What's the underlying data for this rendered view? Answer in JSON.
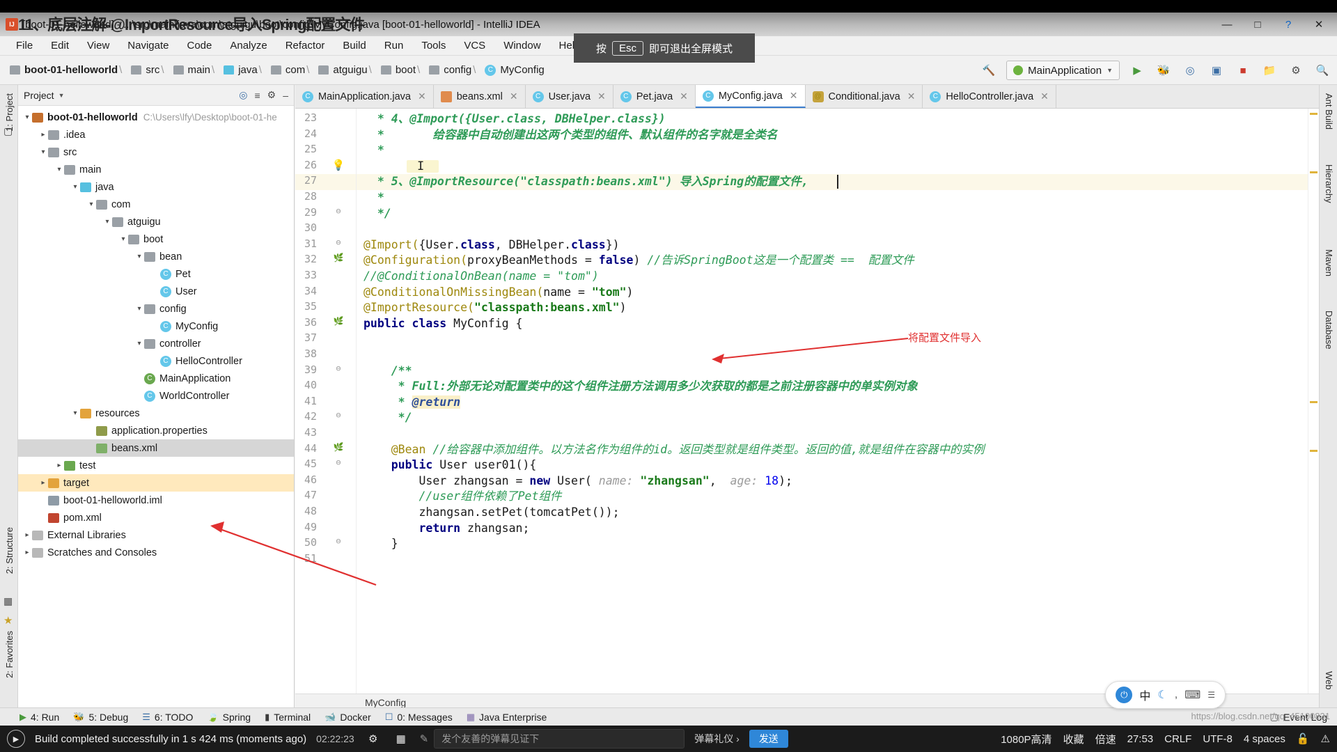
{
  "window": {
    "title": "[boot-01-helloworld] - ...\\src\\main\\java\\com\\atguigu\\boot\\config\\MyConfig.java [boot-01-helloworld] - IntelliJ IDEA",
    "overlay_title": "11、底层注解-@ImportResource导入Spring配置文件",
    "minimize": "—",
    "maximize": "□",
    "close": "✕",
    "help": "?"
  },
  "menubar": {
    "items": [
      "File",
      "Edit",
      "View",
      "Navigate",
      "Code",
      "Analyze",
      "Refactor",
      "Build",
      "Run",
      "Tools",
      "VCS",
      "Window",
      "Help"
    ]
  },
  "esc_hint": {
    "prefix": "按",
    "key": "Esc",
    "suffix": "即可退出全屏模式"
  },
  "navbar": {
    "crumbs": [
      {
        "label": "boot-01-helloworld",
        "icon": "module-icon",
        "bold": true
      },
      {
        "label": "src",
        "icon": "folder-icon"
      },
      {
        "label": "main",
        "icon": "folder-icon"
      },
      {
        "label": "java",
        "icon": "folder-source-icon"
      },
      {
        "label": "com",
        "icon": "folder-icon"
      },
      {
        "label": "atguigu",
        "icon": "folder-icon"
      },
      {
        "label": "boot",
        "icon": "folder-icon"
      },
      {
        "label": "config",
        "icon": "folder-icon"
      },
      {
        "label": "MyConfig",
        "icon": "class-icon"
      }
    ],
    "run_config": "MainApplication",
    "toolbar_icons": [
      "build-hammer-icon",
      "run-icon",
      "debug-icon",
      "coverage-icon",
      "profiler-icon",
      "stop-icon",
      "project-structure-icon",
      "settings-icon",
      "search-icon"
    ]
  },
  "left_strips": {
    "top": [
      "1: Project"
    ],
    "bottom": [
      "2: Structure",
      "2: Favorites"
    ]
  },
  "right_strips": {
    "items": [
      "Ant Build",
      "Hierarchy",
      "Maven",
      "Database",
      "Web"
    ]
  },
  "project_panel": {
    "header": "Project",
    "tree": [
      {
        "indent": 0,
        "arrow": "▾",
        "icon": "module-icon",
        "label": "boot-01-helloworld",
        "bold": true,
        "sub": "C:\\Users\\lfy\\Desktop\\boot-01-he",
        "state": "normal"
      },
      {
        "indent": 1,
        "arrow": "▸",
        "icon": "folder-icon",
        "label": ".idea",
        "state": "normal"
      },
      {
        "indent": 1,
        "arrow": "▾",
        "icon": "folder-icon",
        "label": "src",
        "state": "normal"
      },
      {
        "indent": 2,
        "arrow": "▾",
        "icon": "folder-icon",
        "label": "main",
        "state": "normal"
      },
      {
        "indent": 3,
        "arrow": "▾",
        "icon": "folder-source-icon",
        "label": "java",
        "state": "normal"
      },
      {
        "indent": 4,
        "arrow": "▾",
        "icon": "folder-icon",
        "label": "com",
        "state": "normal"
      },
      {
        "indent": 5,
        "arrow": "▾",
        "icon": "folder-icon",
        "label": "atguigu",
        "state": "normal"
      },
      {
        "indent": 6,
        "arrow": "▾",
        "icon": "folder-icon",
        "label": "boot",
        "state": "normal"
      },
      {
        "indent": 7,
        "arrow": "▾",
        "icon": "folder-icon",
        "label": "bean",
        "state": "normal"
      },
      {
        "indent": 8,
        "arrow": "",
        "icon": "class-icon",
        "label": "Pet",
        "state": "normal"
      },
      {
        "indent": 8,
        "arrow": "",
        "icon": "class-icon",
        "label": "User",
        "state": "normal"
      },
      {
        "indent": 7,
        "arrow": "▾",
        "icon": "folder-icon",
        "label": "config",
        "state": "normal"
      },
      {
        "indent": 8,
        "arrow": "",
        "icon": "class-icon",
        "label": "MyConfig",
        "state": "normal"
      },
      {
        "indent": 7,
        "arrow": "▾",
        "icon": "folder-icon",
        "label": "controller",
        "state": "normal"
      },
      {
        "indent": 8,
        "arrow": "",
        "icon": "class-icon",
        "label": "HelloController",
        "state": "normal"
      },
      {
        "indent": 7,
        "arrow": "",
        "icon": "class-run-icon",
        "label": "MainApplication",
        "state": "normal"
      },
      {
        "indent": 7,
        "arrow": "",
        "icon": "class-icon",
        "label": "WorldController",
        "state": "normal"
      },
      {
        "indent": 3,
        "arrow": "▾",
        "icon": "folder-resources-icon",
        "label": "resources",
        "state": "normal"
      },
      {
        "indent": 4,
        "arrow": "",
        "icon": "properties-icon",
        "label": "application.properties",
        "state": "normal"
      },
      {
        "indent": 4,
        "arrow": "",
        "icon": "xml-icon",
        "label": "beans.xml",
        "state": "selected"
      },
      {
        "indent": 2,
        "arrow": "▸",
        "icon": "folder-test-icon",
        "label": "test",
        "state": "normal"
      },
      {
        "indent": 1,
        "arrow": "▸",
        "icon": "folder-target-icon",
        "label": "target",
        "state": "highlighted"
      },
      {
        "indent": 1,
        "arrow": "",
        "icon": "iml-icon",
        "label": "boot-01-helloworld.iml",
        "state": "normal"
      },
      {
        "indent": 1,
        "arrow": "",
        "icon": "maven-icon",
        "label": "pom.xml",
        "state": "normal"
      },
      {
        "indent": 0,
        "arrow": "▸",
        "icon": "library-icon",
        "label": "External Libraries",
        "state": "normal"
      },
      {
        "indent": 0,
        "arrow": "▸",
        "icon": "scratch-icon",
        "label": "Scratches and Consoles",
        "state": "normal"
      }
    ]
  },
  "editor": {
    "tabs": [
      {
        "label": "MainApplication.java",
        "icon": "java-run-icon",
        "active": false
      },
      {
        "label": "beans.xml",
        "icon": "spring-xml-icon",
        "active": false
      },
      {
        "label": "User.java",
        "icon": "class-icon",
        "active": false
      },
      {
        "label": "Pet.java",
        "icon": "class-icon",
        "active": false
      },
      {
        "label": "MyConfig.java",
        "icon": "class-icon",
        "active": true
      },
      {
        "label": "Conditional.java",
        "icon": "annotation-icon",
        "active": false
      },
      {
        "label": "HelloController.java",
        "icon": "class-icon",
        "active": false
      }
    ],
    "breadcrumb": "MyConfig",
    "current_line": 27,
    "lines": [
      {
        "n": 23,
        "mark": "",
        "segments": [
          {
            "t": "  * 4、@Import({User.class, DBHelper.class})",
            "c": "cmt-b"
          }
        ]
      },
      {
        "n": 24,
        "mark": "",
        "segments": [
          {
            "t": "  *       给容器中自动创建出这两个类型的组件、默认组件的名字就是全类名",
            "c": "cmt-b"
          }
        ]
      },
      {
        "n": 25,
        "mark": "",
        "segments": [
          {
            "t": "  *",
            "c": "cmt-b"
          }
        ]
      },
      {
        "n": 26,
        "mark": "bulb",
        "segments": [
          {
            "t": "  ",
            "c": "cmt-b"
          }
        ]
      },
      {
        "n": 27,
        "mark": "",
        "segments": [
          {
            "t": "  * 5、@ImportResource(\"classpath:beans.xml\") 导入Spring的配置文件,",
            "c": "cmt-b"
          }
        ]
      },
      {
        "n": 28,
        "mark": "",
        "segments": [
          {
            "t": "  *",
            "c": "cmt-b"
          }
        ]
      },
      {
        "n": 29,
        "mark": "fold",
        "segments": [
          {
            "t": "  */",
            "c": "cmt-b"
          }
        ]
      },
      {
        "n": 30,
        "mark": "",
        "segments": [
          {
            "t": "",
            "c": "pl"
          }
        ]
      },
      {
        "n": 31,
        "mark": "fold",
        "segments": [
          {
            "t": "@Import(",
            "c": "ann"
          },
          {
            "t": "{User.",
            "c": "pl"
          },
          {
            "t": "class",
            "c": "kw"
          },
          {
            "t": ", DBHelper.",
            "c": "pl"
          },
          {
            "t": "class",
            "c": "kw"
          },
          {
            "t": "})",
            "c": "pl"
          }
        ]
      },
      {
        "n": 32,
        "mark": "bean",
        "segments": [
          {
            "t": "@Configuration(",
            "c": "ann"
          },
          {
            "t": "proxyBeanMethods = ",
            "c": "pl"
          },
          {
            "t": "false",
            "c": "kw"
          },
          {
            "t": ") ",
            "c": "pl"
          },
          {
            "t": "//告诉SpringBoot这是一个配置类 ==  配置文件",
            "c": "cmt"
          }
        ]
      },
      {
        "n": 33,
        "mark": "",
        "segments": [
          {
            "t": "//@ConditionalOnBean(name = \"tom\")",
            "c": "cmt"
          }
        ]
      },
      {
        "n": 34,
        "mark": "",
        "segments": [
          {
            "t": "@ConditionalOnMissingBean(",
            "c": "ann"
          },
          {
            "t": "name = ",
            "c": "pl"
          },
          {
            "t": "\"tom\"",
            "c": "str"
          },
          {
            "t": ")",
            "c": "pl"
          }
        ]
      },
      {
        "n": 35,
        "mark": "",
        "segments": [
          {
            "t": "@ImportResource(",
            "c": "ann"
          },
          {
            "t": "\"classpath:beans.xml\"",
            "c": "str"
          },
          {
            "t": ")",
            "c": "pl"
          }
        ]
      },
      {
        "n": 36,
        "mark": "beanclass",
        "segments": [
          {
            "t": "public class ",
            "c": "kw"
          },
          {
            "t": "MyConfig {",
            "c": "pl"
          }
        ]
      },
      {
        "n": 37,
        "mark": "",
        "segments": [
          {
            "t": "",
            "c": "pl"
          }
        ]
      },
      {
        "n": 38,
        "mark": "",
        "segments": [
          {
            "t": "",
            "c": "pl"
          }
        ]
      },
      {
        "n": 39,
        "mark": "fold",
        "segments": [
          {
            "t": "    /**",
            "c": "cmt-b"
          }
        ]
      },
      {
        "n": 40,
        "mark": "",
        "segments": [
          {
            "t": "     * Full:外部无论对配置类中的这个组件注册方法调用多少次获取的都是之前注册容器中的单实例对象",
            "c": "cmt-b"
          }
        ]
      },
      {
        "n": 41,
        "mark": "",
        "segments": [
          {
            "t": "     * ",
            "c": "cmt-b"
          },
          {
            "t": "@return",
            "c": "at-ret"
          }
        ]
      },
      {
        "n": 42,
        "mark": "fold",
        "segments": [
          {
            "t": "     */",
            "c": "cmt-b"
          }
        ]
      },
      {
        "n": 43,
        "mark": "",
        "segments": [
          {
            "t": "",
            "c": "pl"
          }
        ]
      },
      {
        "n": 44,
        "mark": "bean2",
        "segments": [
          {
            "t": "    @Bean ",
            "c": "ann"
          },
          {
            "t": "//给容器中添加组件。以方法名作为组件的id。返回类型就是组件类型。返回的值,就是组件在容器中的实例",
            "c": "cmt"
          }
        ]
      },
      {
        "n": 45,
        "mark": "fold",
        "segments": [
          {
            "t": "    public ",
            "c": "kw"
          },
          {
            "t": "User user01(){",
            "c": "pl"
          }
        ]
      },
      {
        "n": 46,
        "mark": "",
        "segments": [
          {
            "t": "        User zhangsan = ",
            "c": "pl"
          },
          {
            "t": "new ",
            "c": "kw"
          },
          {
            "t": "User( ",
            "c": "pl"
          },
          {
            "t": "name:",
            "c": "hint"
          },
          {
            "t": " \"zhangsan\"",
            "c": "str"
          },
          {
            "t": ",  ",
            "c": "pl"
          },
          {
            "t": "age:",
            "c": "hint"
          },
          {
            "t": " ",
            "c": "pl"
          },
          {
            "t": "18",
            "c": "num"
          },
          {
            "t": ");",
            "c": "pl"
          }
        ]
      },
      {
        "n": 47,
        "mark": "",
        "segments": [
          {
            "t": "        //user组件依赖了Pet组件",
            "c": "cmt"
          }
        ]
      },
      {
        "n": 48,
        "mark": "",
        "segments": [
          {
            "t": "        zhangsan.setPet(tomcatPet());",
            "c": "pl"
          }
        ]
      },
      {
        "n": 49,
        "mark": "",
        "segments": [
          {
            "t": "        return ",
            "c": "kw"
          },
          {
            "t": "zhangsan;",
            "c": "pl"
          }
        ]
      },
      {
        "n": 50,
        "mark": "fold",
        "segments": [
          {
            "t": "    }",
            "c": "pl"
          }
        ]
      },
      {
        "n": 51,
        "mark": "",
        "segments": [
          {
            "t": "",
            "c": "pl"
          }
        ]
      }
    ],
    "annotation": {
      "label": "将配置文件导入"
    }
  },
  "bottom_bar": {
    "items": [
      {
        "label": "4: Run",
        "icon": "run-icon"
      },
      {
        "label": "5: Debug",
        "icon": "debug-icon"
      },
      {
        "label": "6: TODO",
        "icon": "todo-icon"
      },
      {
        "label": "Spring",
        "icon": "spring-icon"
      },
      {
        "label": "Terminal",
        "icon": "terminal-icon"
      },
      {
        "label": "Docker",
        "icon": "docker-icon"
      },
      {
        "label": "0: Messages",
        "icon": "messages-icon"
      },
      {
        "label": "Java Enterprise",
        "icon": "java-enterprise-icon"
      }
    ],
    "right": "Event Log"
  },
  "status_bar": {
    "build_message": "Build completed successfully in 1 s 424 ms (moments ago)",
    "recording_time": "02:22:23",
    "ime_placeholder": "发个友善的弹幕见证下",
    "gift_label": "弹幕礼仪 ›",
    "send_label": "发送",
    "quality": "1080P高清",
    "collect": "收藏",
    "speed": "倍速",
    "position": "27:53",
    "git_branch": "CRLF",
    "encoding": "UTF-8",
    "indent": "4 spaces",
    "ime_bar_text": "中",
    "watermark": "https://blog.csdn.net/qq_45100831"
  }
}
